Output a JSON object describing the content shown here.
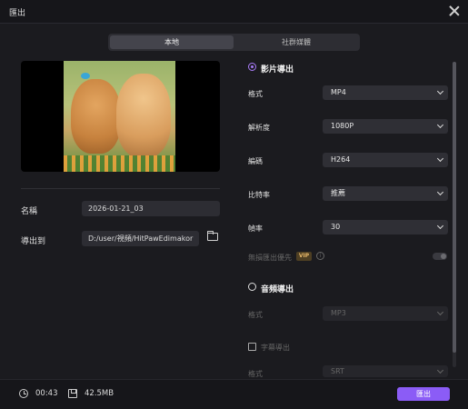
{
  "window": {
    "title": "匯出"
  },
  "tabs": [
    {
      "label": "本地"
    },
    {
      "label": "社群媒體"
    }
  ],
  "left": {
    "name_label": "名稱",
    "name_value": "2026-01-21_03",
    "export_to_label": "導出到",
    "path_value": "D:/user/視頻/HitPawEdimakor"
  },
  "video_section": {
    "title": "影片導出",
    "format_label": "格式",
    "format_value": "MP4",
    "resolution_label": "解析度",
    "resolution_value": "1080P",
    "encoding_label": "編碼",
    "encoding_value": "H264",
    "bitrate_label": "比特率",
    "bitrate_value": "推薦",
    "framerate_label": "幀率",
    "framerate_value": "30",
    "lossless_label": "無損匯出優先",
    "vip_badge": "VIP",
    "info_glyph": "i"
  },
  "audio_section": {
    "title": "音頻導出",
    "format_label": "格式",
    "format_value": "MP3"
  },
  "subtitle_section": {
    "title": "字幕導出",
    "format_label": "格式",
    "format_value": "SRT"
  },
  "footer": {
    "duration": "00:43",
    "size": "42.5MB",
    "export_label": "匯出"
  },
  "colors": {
    "accent": "#8b5cf6",
    "background": "#1b1b1f"
  }
}
